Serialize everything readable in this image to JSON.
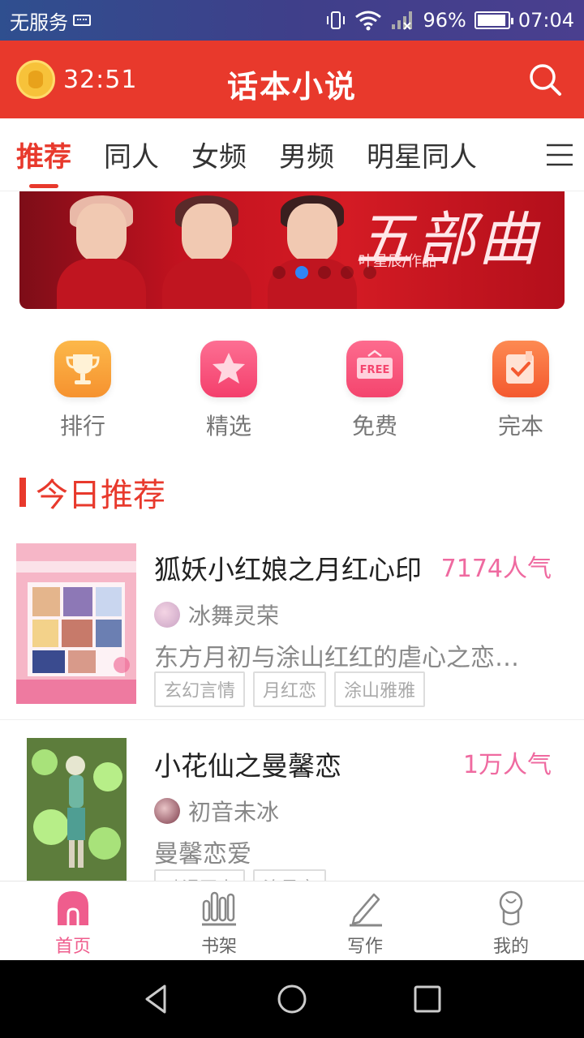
{
  "status_bar": {
    "carrier": "无服务",
    "battery": "96%",
    "time": "07:04"
  },
  "header": {
    "timer": "32:51",
    "title": "话本小说"
  },
  "tabs": [
    {
      "label": "推荐",
      "active": true
    },
    {
      "label": "同人",
      "active": false
    },
    {
      "label": "女频",
      "active": false
    },
    {
      "label": "男频",
      "active": false
    },
    {
      "label": "明星同人",
      "active": false
    }
  ],
  "banner": {
    "title": "五部曲",
    "author": "叶星辰/作品",
    "slide_count": 5,
    "active_slide": 1
  },
  "quick_entries": [
    {
      "label": "排行",
      "icon": "trophy-icon",
      "color": "#f9a13a"
    },
    {
      "label": "精选",
      "icon": "star-icon",
      "color": "#f9547f"
    },
    {
      "label": "免费",
      "icon": "free-icon",
      "color": "#f6557a"
    },
    {
      "label": "完本",
      "icon": "check-book-icon",
      "color": "#f76b3d"
    }
  ],
  "section": {
    "title": "今日推荐"
  },
  "books": [
    {
      "title": "狐妖小红娘之月红心印",
      "popularity": "7174人气",
      "author": "冰舞灵荣",
      "description": "东方月初与涂山红红的虐心之恋…",
      "tags": [
        "玄幻言情",
        "月红恋",
        "涂山雅雅"
      ]
    },
    {
      "title": "小花仙之曼馨恋",
      "popularity": "1万人气",
      "author": "初音未冰",
      "description": "曼馨恋爱",
      "tags": [
        "动漫同人",
        "汐曼恋"
      ]
    }
  ],
  "bottom_nav": [
    {
      "label": "首页",
      "icon": "home-icon",
      "active": true
    },
    {
      "label": "书架",
      "icon": "bookshelf-icon",
      "active": false
    },
    {
      "label": "写作",
      "icon": "pen-icon",
      "active": false
    },
    {
      "label": "我的",
      "icon": "profile-icon",
      "active": false
    }
  ],
  "colors": {
    "brand": "#e8392c",
    "accent_pink": "#ef5d8d",
    "popularity": "#ef6aa0"
  }
}
